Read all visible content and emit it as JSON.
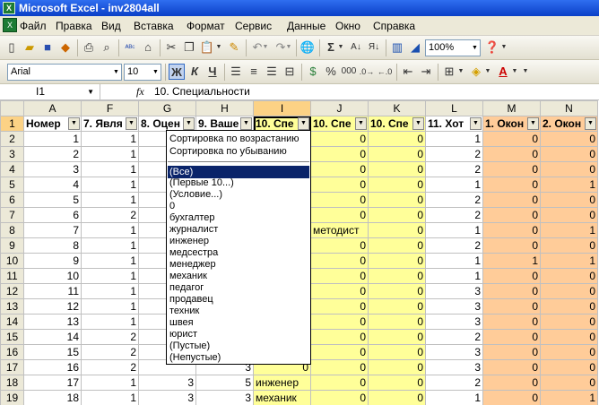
{
  "window": {
    "title": "Microsoft Excel - inv2804all"
  },
  "menu": [
    "Файл",
    "Правка",
    "Вид",
    "Вставка",
    "Формат",
    "Сервис",
    "Данные",
    "Окно",
    "Справка"
  ],
  "toolbar": {
    "zoom": "100%",
    "font": "Arial",
    "size": "10",
    "bold": "Ж",
    "italic": "К",
    "underline": "Ч",
    "currency": "%",
    "thousands": "000"
  },
  "formula_bar": {
    "name_box": "I1",
    "fx": "fx",
    "value": "10. Специальности"
  },
  "columns": [
    "A",
    "F",
    "G",
    "H",
    "I",
    "J",
    "K",
    "L",
    "M",
    "N"
  ],
  "headers": [
    "Номер",
    "7. Явля",
    "8. Оцен",
    "9. Ваше",
    "10. Спе",
    "10. Спе",
    "10. Спе",
    "11. Хот",
    "1. Окон",
    "2. Окон"
  ],
  "rows": [
    {
      "n": "2",
      "a": "1",
      "f": "1",
      "j": "0",
      "k": "0",
      "l": "1",
      "m": "0",
      "nn": "0"
    },
    {
      "n": "3",
      "a": "2",
      "f": "1",
      "j": "0",
      "k": "0",
      "l": "2",
      "m": "0",
      "nn": "0"
    },
    {
      "n": "4",
      "a": "3",
      "f": "1",
      "j": "0",
      "k": "0",
      "l": "2",
      "m": "0",
      "nn": "0"
    },
    {
      "n": "5",
      "a": "4",
      "f": "1",
      "j": "0",
      "k": "0",
      "l": "1",
      "m": "0",
      "nn": "1"
    },
    {
      "n": "6",
      "a": "5",
      "f": "1",
      "j": "0",
      "k": "0",
      "l": "2",
      "m": "0",
      "nn": "0"
    },
    {
      "n": "7",
      "a": "6",
      "f": "2",
      "j": "0",
      "k": "0",
      "l": "2",
      "m": "0",
      "nn": "0"
    },
    {
      "n": "8",
      "a": "7",
      "f": "1",
      "j": "методист",
      "k": "0",
      "l": "1",
      "m": "0",
      "nn": "1"
    },
    {
      "n": "9",
      "a": "8",
      "f": "1",
      "j": "0",
      "k": "0",
      "l": "2",
      "m": "0",
      "nn": "0"
    },
    {
      "n": "10",
      "a": "9",
      "f": "1",
      "j": "0",
      "k": "0",
      "l": "1",
      "m": "1",
      "nn": "1"
    },
    {
      "n": "11",
      "a": "10",
      "f": "1",
      "j": "0",
      "k": "0",
      "l": "1",
      "m": "0",
      "nn": "0"
    },
    {
      "n": "12",
      "a": "11",
      "f": "1",
      "j": "0",
      "k": "0",
      "l": "3",
      "m": "0",
      "nn": "0"
    },
    {
      "n": "13",
      "a": "12",
      "f": "1",
      "j": "0",
      "k": "0",
      "l": "3",
      "m": "0",
      "nn": "0"
    },
    {
      "n": "14",
      "a": "13",
      "f": "1",
      "j": "0",
      "k": "0",
      "l": "3",
      "m": "0",
      "nn": "0"
    },
    {
      "n": "15",
      "a": "14",
      "f": "2",
      "j": "0",
      "k": "0",
      "l": "2",
      "m": "0",
      "nn": "0"
    },
    {
      "n": "16",
      "a": "15",
      "f": "2",
      "j": "0",
      "k": "0",
      "l": "3",
      "m": "0",
      "nn": "0"
    },
    {
      "n": "17",
      "a": "16",
      "f": "2",
      "h": "3",
      "i": "0",
      "j": "0",
      "k": "0",
      "l": "3",
      "m": "0",
      "nn": "0"
    },
    {
      "n": "18",
      "a": "17",
      "f": "1",
      "g": "3",
      "h": "5",
      "i": "инженер",
      "j": "0",
      "k": "0",
      "l": "2",
      "m": "0",
      "nn": "0"
    },
    {
      "n": "19",
      "a": "18",
      "f": "1",
      "g": "3",
      "h": "3",
      "i": "механик",
      "j": "0",
      "k": "0",
      "l": "1",
      "m": "0",
      "nn": "1"
    }
  ],
  "dropdown": {
    "sort": [
      "Сортировка по возрастанию",
      "Сортировка по убыванию"
    ],
    "items": [
      "(Все)",
      "(Первые 10...)",
      "(Условие...)",
      "0",
      "бухгалтер",
      "журналист",
      "инженер",
      "медсестра",
      "менеджер",
      "механик",
      "педагог",
      "продавец",
      "техник",
      "швея",
      "юрист",
      "(Пустые)",
      "(Непустые)"
    ]
  }
}
